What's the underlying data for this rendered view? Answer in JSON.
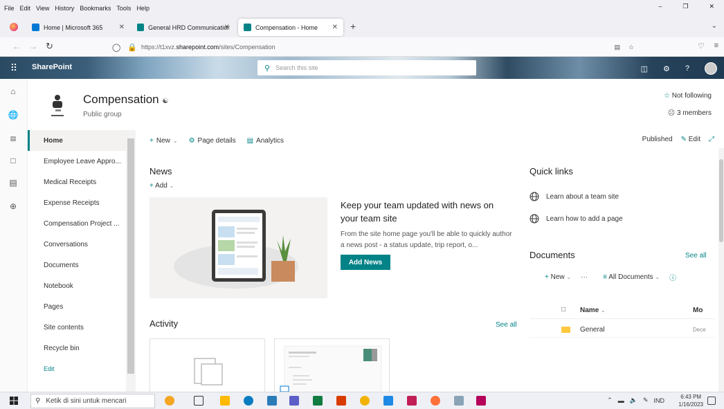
{
  "menu": [
    "File",
    "Edit",
    "View",
    "History",
    "Bookmarks",
    "Tools",
    "Help"
  ],
  "tabs": [
    {
      "label": "Home | Microsoft 365",
      "color": "#0078d4"
    },
    {
      "label": "General HRD Communication S",
      "color": "#038387"
    },
    {
      "label": "Compensation - Home",
      "color": "#038387"
    }
  ],
  "url": {
    "prefix": "https://t1xvz.",
    "host": "sharepoint.com",
    "path": "/sites/Compensation"
  },
  "sp": {
    "brand": "SharePoint",
    "search_placeholder": "Search this site"
  },
  "site": {
    "title": "Compensation",
    "subtitle": "Public group",
    "follow": "Not following",
    "members": "3 members"
  },
  "nav": {
    "items": [
      "Home",
      "Employee Leave Appro...",
      "Medical Receipts",
      "Expense Receipts",
      "Compensation Project ...",
      "Conversations",
      "Documents",
      "Notebook",
      "Pages",
      "Site contents",
      "Recycle bin",
      "Edit"
    ]
  },
  "cmd": {
    "new": "New",
    "page_details": "Page details",
    "analytics": "Analytics",
    "published": "Published",
    "edit": "Edit"
  },
  "news": {
    "title": "News",
    "add": "Add",
    "headline": "Keep your team updated with news on your team site",
    "description": "From the site home page you'll be able to quickly author a news post - a status update, trip report, o...",
    "button": "Add News"
  },
  "activity": {
    "title": "Activity",
    "see_all": "See all"
  },
  "quick_links": {
    "title": "Quick links",
    "items": [
      "Learn about a team site",
      "Learn how to add a page"
    ]
  },
  "documents": {
    "title": "Documents",
    "see_all": "See all",
    "new": "New",
    "more": "···",
    "view": "All Documents",
    "col_name": "Name",
    "col_modified": "Mo",
    "rows": [
      {
        "name": "General",
        "modified": "Dece"
      }
    ]
  },
  "taskbar": {
    "search": "Ketik di sini untuk mencari",
    "lang": "IND",
    "time": "6:43 PM",
    "date": "1/16/2023"
  },
  "colors": {
    "accent": "#038387"
  }
}
